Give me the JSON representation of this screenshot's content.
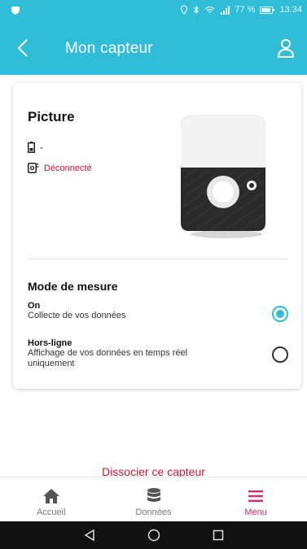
{
  "status_bar": {
    "battery_percent": "77 %",
    "time": "13:34"
  },
  "app_bar": {
    "title": "Mon capteur"
  },
  "sensor": {
    "name": "Picture",
    "battery_value": "-",
    "connection_status": "Déconnecté"
  },
  "measurement_mode": {
    "title": "Mode de mesure",
    "options": [
      {
        "label": "On",
        "description": "Collecte de vos données",
        "selected": true
      },
      {
        "label": "Hors-ligne",
        "description": "Affichage de vos données en temps réel uniquement",
        "selected": false
      }
    ]
  },
  "actions": {
    "dissociate_label": "Dissocier ce capteur"
  },
  "bottom_nav": {
    "items": [
      {
        "label": "Accueil",
        "icon": "home-icon",
        "active": false
      },
      {
        "label": "Données",
        "icon": "database-icon",
        "active": false
      },
      {
        "label": "Menu",
        "icon": "menu-icon",
        "active": true
      }
    ]
  },
  "colors": {
    "primary": "#30bdd8",
    "accent": "#e0266c",
    "error": "#d9142b"
  }
}
